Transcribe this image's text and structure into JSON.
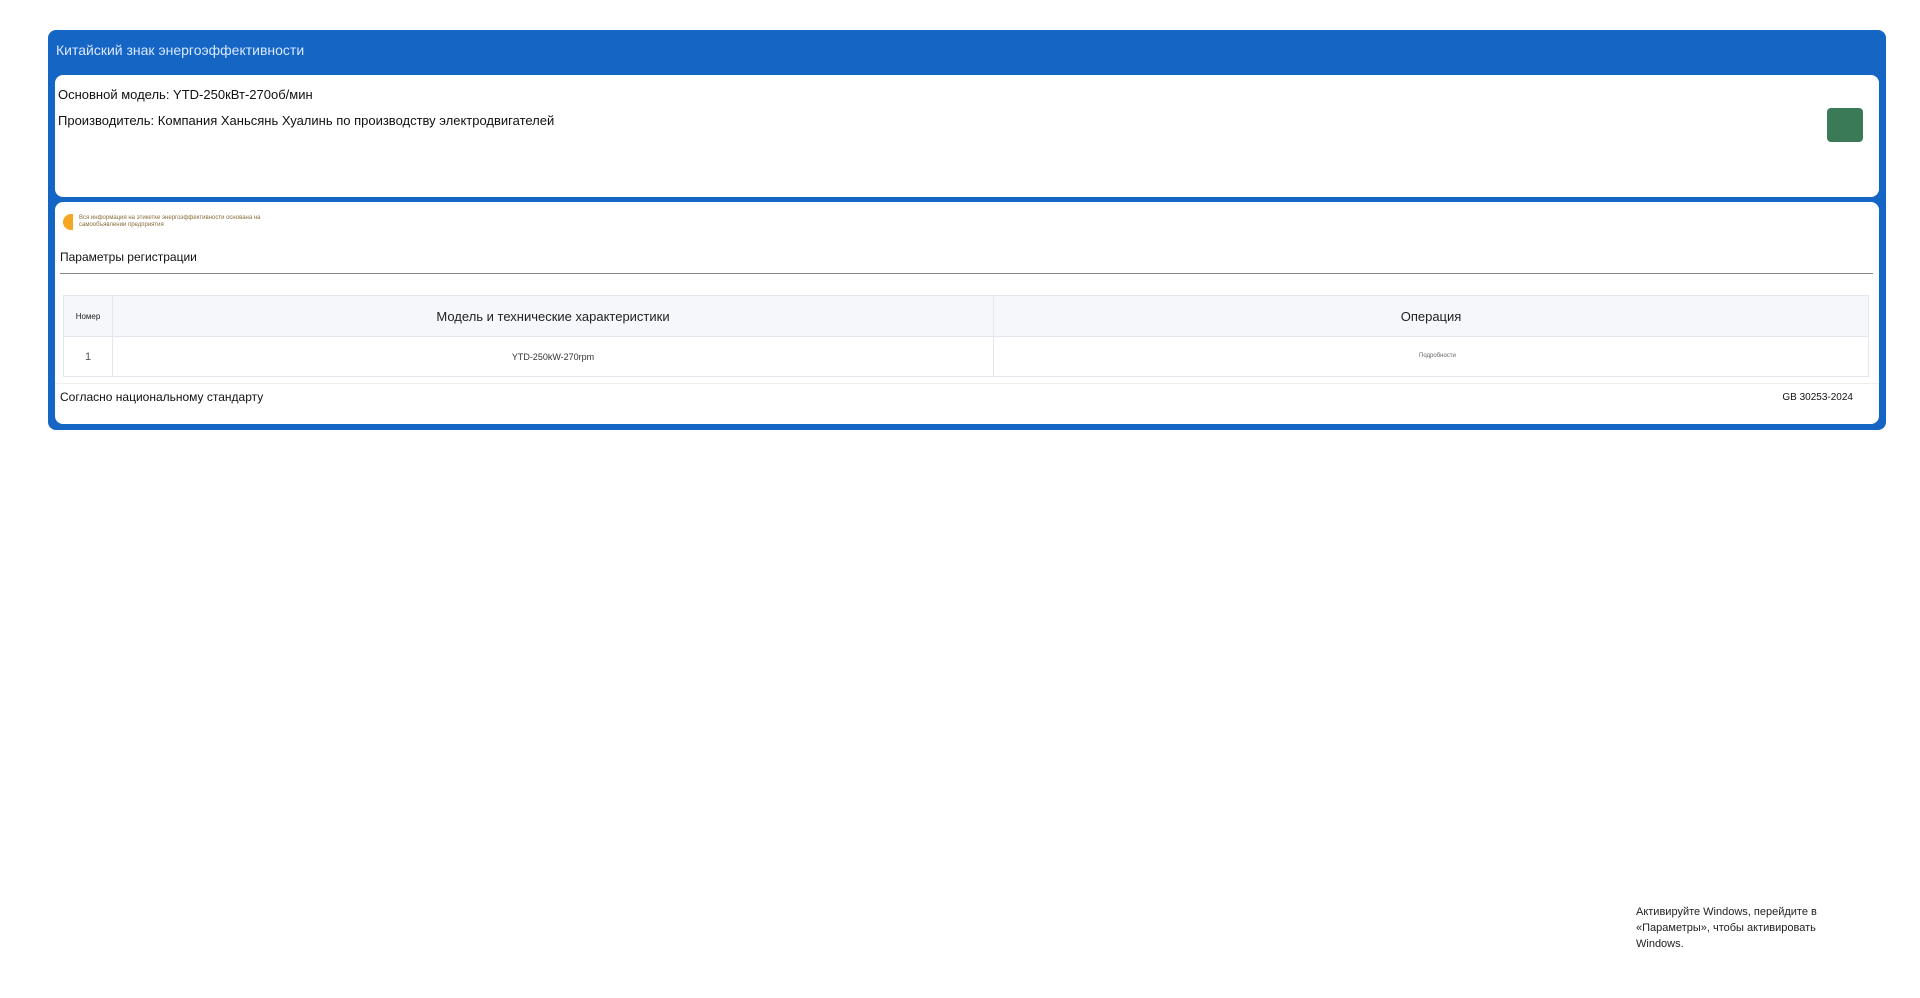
{
  "window": {
    "title": "Китайский знак энергоэффективности"
  },
  "info": {
    "model_line": "Основной модель: YTD-250кВт-270об/мин",
    "manufacturer_line": "Производитель: Компания Ханьсянь Хуалинь по производству электродвигателей"
  },
  "colors": {
    "frame": "#1565c5",
    "badge": "#3b7a57",
    "notice_accent": "#f5a623"
  },
  "registration": {
    "notice": "Вся информация на этикетке энергоэффективности основана на самообъявлении предприятия",
    "heading": "Параметры регистрации",
    "table": {
      "headers": {
        "number": "Номер",
        "model": "Модель и технические характеристики",
        "operation": "Операция"
      },
      "rows": [
        {
          "number": "1",
          "model": "YTD-250kW-270rpm",
          "operation": "Подробности"
        }
      ]
    },
    "standard": {
      "label": "Согласно национальному стандарту",
      "code": "GB 30253-2024"
    }
  },
  "os_watermark": {
    "text": "Активируйте Windows, перейдите в «Параметры», чтобы активировать Windows."
  }
}
